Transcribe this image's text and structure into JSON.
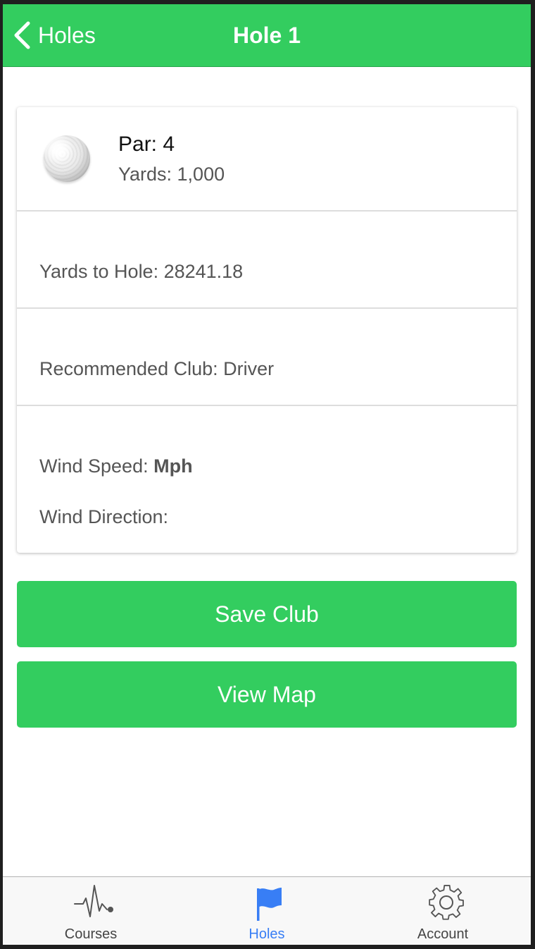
{
  "header": {
    "back_label": "Holes",
    "title": "Hole 1"
  },
  "hole": {
    "par": "Par: 4",
    "yards": "Yards: 1,000",
    "image_icon": "golf-ball"
  },
  "details": {
    "yards_to_hole": "Yards to Hole: 28241.18",
    "recommended_club": "Recommended Club: Driver",
    "wind_speed_label": "Wind Speed: ",
    "wind_speed_unit": "Mph",
    "wind_direction": "Wind Direction:"
  },
  "buttons": {
    "save_club": "Save Club",
    "view_map": "View Map"
  },
  "tabs": [
    {
      "label": "Courses",
      "icon": "pulse-icon",
      "active": false
    },
    {
      "label": "Holes",
      "icon": "flag-icon",
      "active": true
    },
    {
      "label": "Account",
      "icon": "gear-icon",
      "active": false
    }
  ],
  "colors": {
    "primary": "#33cd5f",
    "tab_active": "#387ef5",
    "text_muted": "#555555"
  }
}
